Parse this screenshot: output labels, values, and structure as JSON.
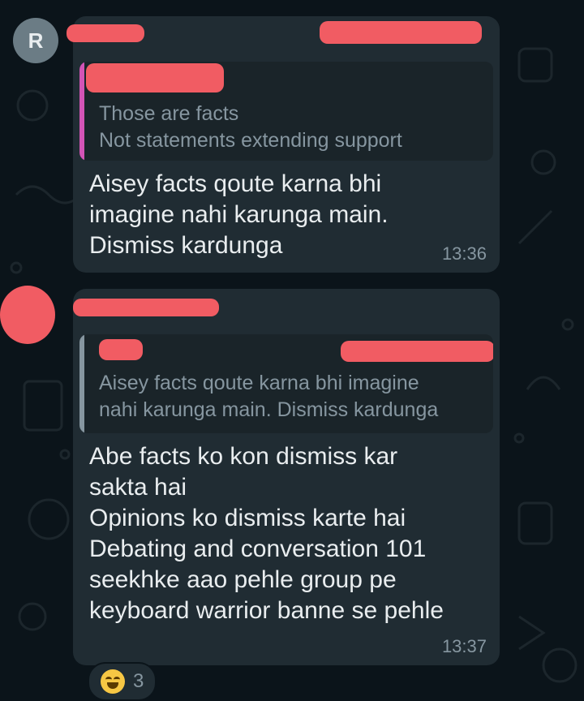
{
  "theme": {
    "background": "#0b141a",
    "bubble": "#202c33",
    "quote_bar_1": "#d354b6",
    "quote_bar_2": "#8696a0",
    "redaction": "#f15c63"
  },
  "messages": [
    {
      "avatar_initial": "R",
      "quote_text": "Those are facts\nNot statements extending support",
      "text": "Aisey facts qoute karna bhi\nimagine nahi karunga main.\nDismiss kardunga",
      "time": "13:36"
    },
    {
      "quote_text": "Aisey facts qoute karna bhi imagine\nnahi karunga main. Dismiss kardunga",
      "text": "Abe facts ko kon dismiss kar\nsakta hai\nOpinions ko dismiss karte hai\nDebating and conversation 101\nseekhke aao pehle group pe\nkeyboard warrior banne se pehle",
      "time": "13:37",
      "reaction": {
        "icon": "laughing-tears-emoji-icon",
        "count": "3"
      }
    }
  ]
}
